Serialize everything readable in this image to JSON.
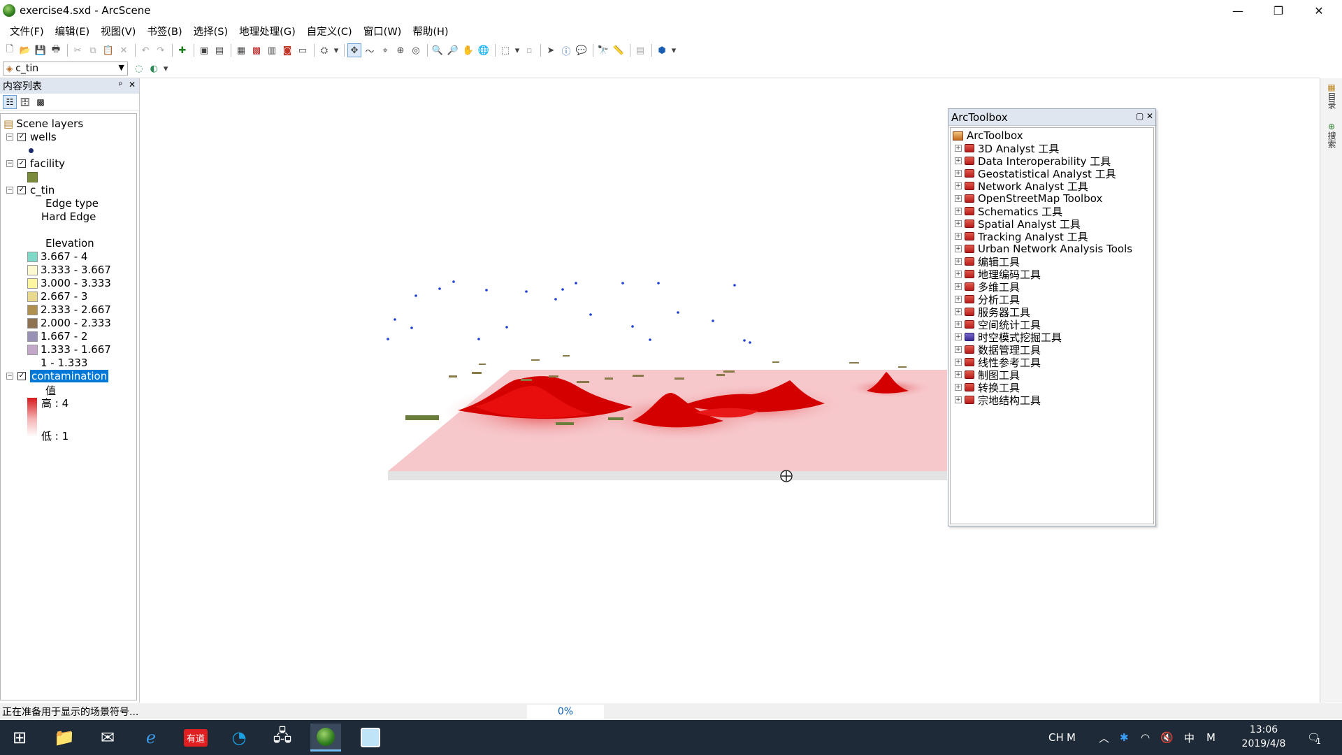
{
  "window": {
    "title": "exercise4.sxd - ArcScene",
    "minimize": "—",
    "restore": "❐",
    "close": "✕"
  },
  "menu": [
    "文件(F)",
    "编辑(E)",
    "视图(V)",
    "书签(B)",
    "选择(S)",
    "地理处理(G)",
    "自定义(C)",
    "窗口(W)",
    "帮助(H)"
  ],
  "layer_select": {
    "value": "c_tin"
  },
  "toc": {
    "title": "内容列表",
    "pin": "ᵖ",
    "close": "✕",
    "root": "Scene layers",
    "layers": {
      "wells": {
        "name": "wells"
      },
      "facility": {
        "name": "facility"
      },
      "c_tin": {
        "name": "c_tin",
        "edge_heading": "Edge type",
        "edge_value": "Hard Edge",
        "elev_heading": "Elevation",
        "classes": [
          {
            "label": "3.667 - 4",
            "color": "#7fd9c8"
          },
          {
            "label": "3.333 - 3.667",
            "color": "#fbf9cf"
          },
          {
            "label": "3.000 - 3.333",
            "color": "#fcf6a0"
          },
          {
            "label": "2.667 - 3",
            "color": "#e9d98d"
          },
          {
            "label": "2.333 - 2.667",
            "color": "#b09050"
          },
          {
            "label": "2.000 - 2.333",
            "color": "#8e7251"
          },
          {
            "label": "1.667 - 2",
            "color": "#9a92b6"
          },
          {
            "label": "1.333 - 1.667",
            "color": "#c3a7c9"
          },
          {
            "label": "1 - 1.333",
            "color": "#ffffff"
          }
        ]
      },
      "contamination": {
        "name": "contamination",
        "value_heading": "值",
        "high": "高 : 4",
        "low": "低 : 1",
        "high_color": "#d7191c",
        "low_color": "#ffffff"
      }
    }
  },
  "arctoolbox": {
    "title": "ArcToolbox",
    "root": "ArcToolbox",
    "items": [
      "3D Analyst 工具",
      "Data Interoperability 工具",
      "Geostatistical Analyst 工具",
      "Network Analyst 工具",
      "OpenStreetMap Toolbox",
      "Schematics 工具",
      "Spatial Analyst 工具",
      "Tracking Analyst 工具",
      "Urban Network Analysis Tools",
      "编辑工具",
      "地理编码工具",
      "多维工具",
      "分析工具",
      "服务器工具",
      "空间统计工具",
      "时空模式挖掘工具",
      "数据管理工具",
      "线性参考工具",
      "制图工具",
      "转换工具",
      "宗地结构工具"
    ]
  },
  "right_tabs": [
    "目录",
    "搜索"
  ],
  "status": {
    "text": "正在准备用于显示的场景符号...",
    "progress": "0%"
  },
  "taskbar": {
    "tray_ime1": "CH",
    "tray_ime2": "M",
    "tray_lang": "中",
    "tray_m": "M",
    "time": "13:06",
    "date": "2019/4/8",
    "notification_count": "1"
  },
  "colors": {
    "contamination_peak": "#d40000",
    "tin_base": "#f6c7cb",
    "wells_point": "#1f3fd6",
    "facility": "#6b7d3a",
    "selection": "#0078d7"
  }
}
